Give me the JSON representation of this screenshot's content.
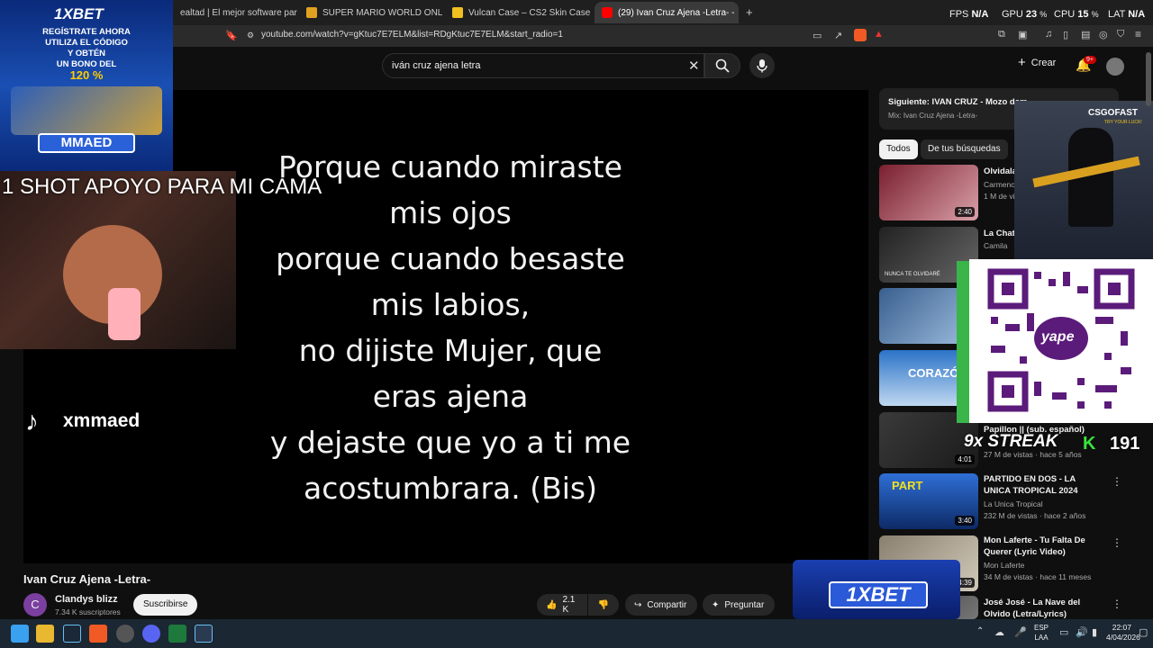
{
  "browser": {
    "tabs": [
      {
        "label": "ealtad | El mejor software para pote",
        "active": false,
        "color": "#555"
      },
      {
        "label": "SUPER MARIO WORLD ONLINE juego",
        "active": false,
        "color": "#e0a020"
      },
      {
        "label": "Vulcan Case – CS2 Skin Case Openin",
        "active": false,
        "color": "#f0c020"
      },
      {
        "label": "(29) Ivan Cruz Ajena -Letra- -",
        "active": true,
        "color": "#ff0000"
      }
    ],
    "new_tab": "+",
    "url": "youtube.com/watch?v=gKtuc7E7ELM&list=RDgKtuc7E7ELM&start_radio=1"
  },
  "hud": {
    "fps_label": "FPS",
    "fps_value": "N/A",
    "gpu_label": "GPU",
    "gpu_value": "23",
    "cpu_label": "CPU",
    "cpu_value": "15",
    "lat_label": "LAT",
    "lat_value": "N/A"
  },
  "youtube": {
    "search_value": "iván cruz ajena letra",
    "create_label": "Crear",
    "notif_count": "9+"
  },
  "video": {
    "lyrics": [
      "Porque cuando miraste",
      "mis ojos",
      "porque cuando besaste",
      "mis labios,",
      "no dijiste Mujer, que",
      "eras ajena",
      "y dejaste que yo a ti me",
      "acostumbrara. (Bis)"
    ],
    "title": "Ivan Cruz Ajena -Letra-",
    "channel": "Clandys blizz",
    "channel_initial": "C",
    "subscribers": "7.34 K suscriptores",
    "subscribe_label": "Suscribirse",
    "likes": "2.1 K",
    "share_label": "Compartir",
    "ask_label": "Preguntar"
  },
  "overlays": {
    "ad_brand": "1XBET",
    "ad_lines": [
      "REGÍSTRATE AHORA",
      "UTILIZA EL CÓDIGO",
      "Y OBTÉN",
      "UN BONO DEL",
      "120 %"
    ],
    "ad_code": "MMAED",
    "shot_text": "1 SHOT APOYO PARA MI CAMA",
    "tiktok_name": "xmmaed",
    "csgo_brand": "CSGOFAST",
    "csgo_tag": "TRY YOUR LUCK!",
    "yape": "yape",
    "streak_label": "9x STREAK",
    "streak_count": "191",
    "bottom_ad_brand": "1XBET"
  },
  "sidebar": {
    "next_label": "Siguiente: IVAN CRUZ - Mozo dem",
    "mix_label": "Mix: Ivan Cruz Ajena -Letra-",
    "chips": [
      "Todos",
      "De tus búsquedas"
    ],
    "videos": [
      {
        "title": "Olvidala",
        "meta1": "Carmencit",
        "meta2": "1 M de vis",
        "duration": "2:40"
      },
      {
        "title": "La Chata",
        "meta1": "Camila",
        "meta2": "",
        "duration": ""
      },
      {
        "title": "",
        "meta1": "",
        "meta2": "",
        "duration": ""
      },
      {
        "title": "",
        "meta1": "",
        "meta2": "",
        "duration": ""
      },
      {
        "title": "Papillon || (sub. español)",
        "meta1": "27 M de vistas · hace 5 años",
        "meta2": "",
        "duration": "4:01"
      },
      {
        "title": "PARTIDO EN DOS - LA UNICA TROPICAL 2024",
        "meta1": "La Unica Tropical",
        "meta2": "232 M de vistas · hace 2 años",
        "duration": "3:40"
      },
      {
        "title": "Mon Laferte - Tu Falta De Querer (Lyric Video)",
        "meta1": "Mon Laferte",
        "meta2": "34 M de vistas · hace 11 meses",
        "duration": "4:39"
      },
      {
        "title": "José José - La Nave del Olvido (Letra/Lyrics)",
        "meta1": "",
        "meta2": "",
        "duration": ""
      }
    ],
    "thumb_texts": [
      "CORAZÓN",
      "PART",
      "NUNCA TE OLVIDARÉ"
    ]
  },
  "taskbar": {
    "lang_top": "ESP",
    "lang_bottom": "LAA",
    "time": "22:07",
    "date": "4/04/2026"
  }
}
